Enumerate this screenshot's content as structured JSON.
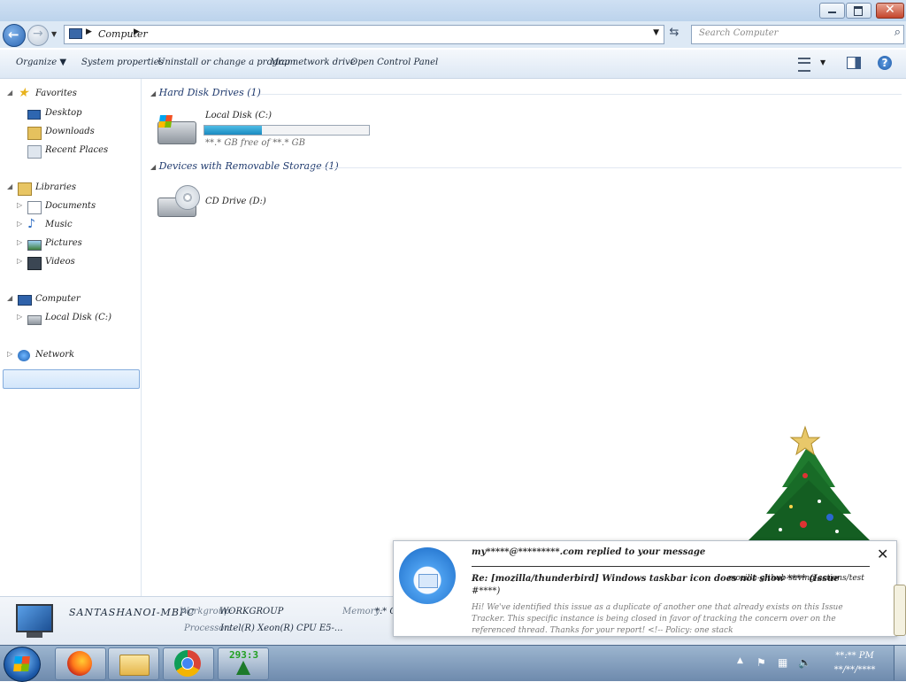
{
  "window": {
    "address_crumb": "Computer",
    "search_placeholder": "Search Computer"
  },
  "toolbar": {
    "organize": "Organize",
    "system_properties": "System properties",
    "uninstall": "Uninstall or change a program",
    "map_network_drive": "Map network drive",
    "control_panel": "Open Control Panel"
  },
  "nav": {
    "favorites": "Favorites",
    "desktop": "Desktop",
    "downloads": "Downloads",
    "recent_places": "Recent Places",
    "libraries": "Libraries",
    "documents": "Documents",
    "music": "Music",
    "pictures": "Pictures",
    "videos": "Videos",
    "computer": "Computer",
    "local_disk": "Local Disk (C:)",
    "network": "Network"
  },
  "content": {
    "hdd_group": "Hard Disk Drives (1)",
    "removable_group": "Devices with Removable Storage (1)",
    "drive_c": {
      "name": "Local Disk (C:)",
      "free_text": "**.* GB free of **.* GB",
      "used_fraction": 0.35
    },
    "drive_d": {
      "name": "CD Drive (D:)"
    }
  },
  "details": {
    "computer_name": "SANTASHANOI-MBPC",
    "workgroup_label": "Workgroup:",
    "workgroup_value": "WORKGROUP",
    "memory_label": "Memory:",
    "memory_value": "*.* GB",
    "processor_label": "Processor:",
    "processor_value": "Intel(R) Xeon(R) CPU E5-..."
  },
  "toast": {
    "from": "my*****@*********.com replied to your message",
    "subject": "Re: [mozilla/thunderbird] Windows taskbar icon does not show **** (Issue",
    "subject_repo": "mozilla-github-saving-actions/test",
    "subject_num": "#****)",
    "body": "Hi! We've identified this issue as a duplicate of another one that already exists on this Issue Tracker. This specific instance is being closed in favor of tracking the concern over on the referenced thread. Thanks for your report! <!-- Policy: one stack"
  },
  "taskbar": {
    "counter": "293:3",
    "clock_time": "**:** PM",
    "clock_date": "**/**/****"
  },
  "colors": {
    "accent": "#1f5aa6",
    "group_header": "#1f3a6e",
    "disk_bar": "#1a8ac0"
  }
}
